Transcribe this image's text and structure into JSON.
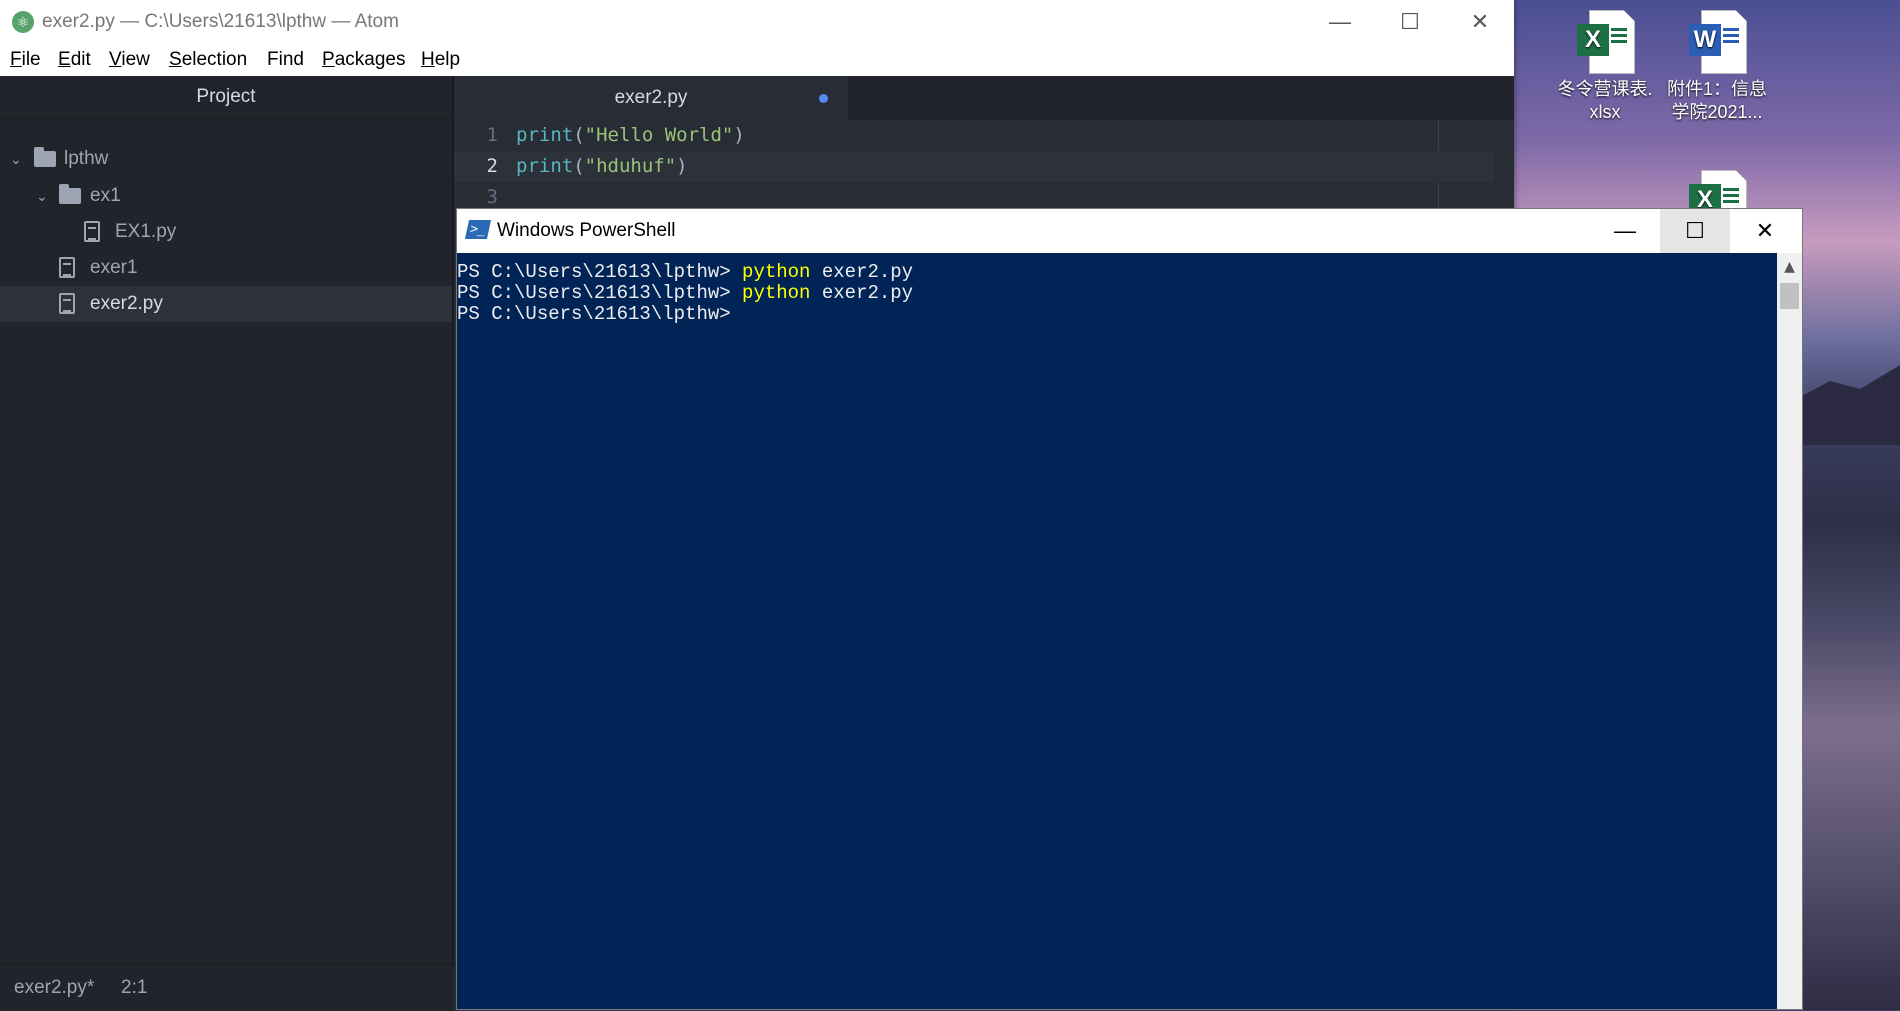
{
  "desktop": {
    "icons": [
      {
        "type": "excel",
        "badge": "X",
        "line1": "冬令营课表.",
        "line2": "xlsx"
      },
      {
        "type": "word",
        "badge": "W",
        "line1": "附件1：信息",
        "line2": "学院2021..."
      },
      {
        "type": "excel",
        "badge": "X",
        "line1": "",
        "line2": ""
      }
    ],
    "colors": {
      "excel": "#1d7044",
      "word": "#2b5fb5"
    }
  },
  "atom": {
    "title": "exer2.py — C:\\Users\\21613\\lpthw — Atom",
    "window_controls": {
      "minimize": "—",
      "maximize": "☐",
      "close": "✕"
    },
    "menu": [
      {
        "key": "F",
        "rest": "ile"
      },
      {
        "key": "E",
        "rest": "dit"
      },
      {
        "key": "V",
        "rest": "iew"
      },
      {
        "key": "S",
        "rest": "election"
      },
      {
        "key": "",
        "rest": "Find"
      },
      {
        "key": "P",
        "rest": "ackages"
      },
      {
        "key": "H",
        "rest": "elp"
      }
    ],
    "project": {
      "header": "Project",
      "tree": [
        {
          "label": "lpthw",
          "kind": "folder",
          "chevron": "⌄"
        },
        {
          "label": "ex1",
          "kind": "folder",
          "chevron": "⌄"
        },
        {
          "label": "EX1.py",
          "kind": "file"
        },
        {
          "label": "exer1",
          "kind": "file"
        },
        {
          "label": "exer2.py",
          "kind": "file",
          "selected": true
        }
      ]
    },
    "tab": {
      "label": "exer2.py",
      "modified": true
    },
    "code": [
      {
        "n": "1",
        "fn": "print",
        "open": "(",
        "str": "\"Hello World\"",
        "close": ")"
      },
      {
        "n": "2",
        "fn": "print",
        "open": "(",
        "str": "\"hduhuf\"",
        "close": ")"
      },
      {
        "n": "3",
        "fn": "",
        "open": "",
        "str": "",
        "close": ""
      }
    ],
    "status": {
      "file": "exer2.py*",
      "cursor": "2:1"
    },
    "colors": {
      "bg": "#282c34",
      "sidebar": "#21252b",
      "accent": "#568af2"
    }
  },
  "powershell": {
    "title": "Windows PowerShell",
    "icon_glyph": ">_",
    "window_controls": {
      "minimize": "—",
      "maximize": "☐",
      "close": "✕"
    },
    "lines": [
      {
        "prompt": "PS C:\\Users\\21613\\lpthw> ",
        "cmd": "python",
        "args": " exer2.py"
      },
      {
        "prompt": "PS C:\\Users\\21613\\lpthw> ",
        "cmd": "python",
        "args": " exer2.py"
      },
      {
        "prompt": "PS C:\\Users\\21613\\lpthw>",
        "cmd": "",
        "args": ""
      }
    ],
    "scroll_up": "▲",
    "colors": {
      "bg": "#012456",
      "text": "#eeedf0",
      "command": "#ffff00"
    }
  }
}
